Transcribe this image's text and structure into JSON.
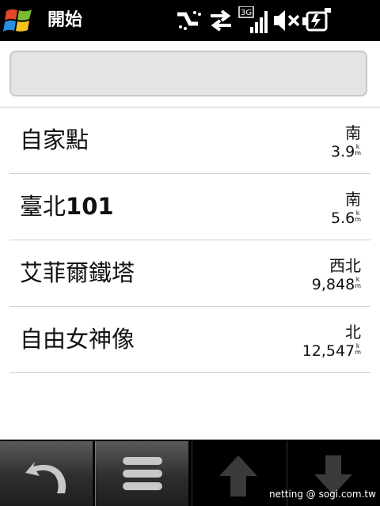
{
  "statusbar": {
    "title": "開始",
    "network_label": "3G",
    "icons": [
      "windows-start-icon",
      "sync-icon",
      "data-transfer-icon",
      "signal-strength-icon",
      "speaker-muted-icon",
      "battery-charging-icon"
    ]
  },
  "search": {
    "value": ""
  },
  "places": [
    {
      "name": "自家點",
      "direction": "南",
      "distance": "3.9",
      "unit_top": "k",
      "unit_bottom": "m"
    },
    {
      "name": "臺北",
      "name_latin": "101",
      "direction": "南",
      "distance": "5.6",
      "unit_top": "k",
      "unit_bottom": "m"
    },
    {
      "name": "艾菲爾鐵塔",
      "direction": "西北",
      "distance": "9,848",
      "unit_top": "k",
      "unit_bottom": "m"
    },
    {
      "name": "自由女神像",
      "direction": "北",
      "distance": "12,547",
      "unit_top": "k",
      "unit_bottom": "m"
    }
  ],
  "toolbar": {
    "icons": [
      "back-arrow-icon",
      "menu-icon",
      "up-arrow-icon",
      "down-arrow-icon"
    ]
  },
  "watermark": "netting   @ sogi.com.tw",
  "colors": {
    "statusbar": "#000000",
    "separator": "#cfcfcf",
    "search_fill": "#e4e4e4"
  }
}
